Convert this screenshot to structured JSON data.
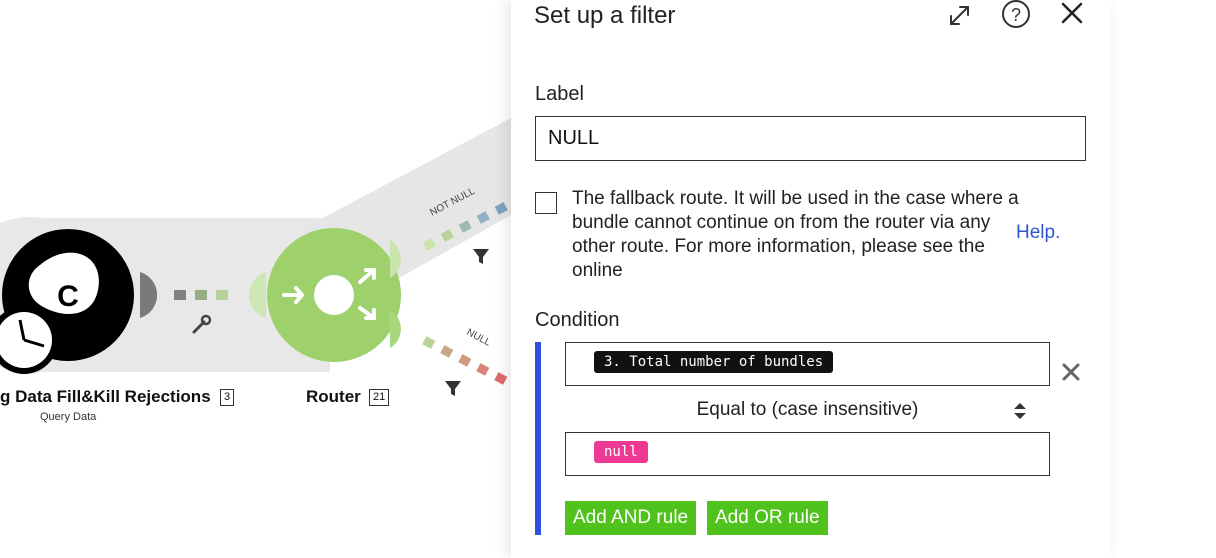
{
  "canvas": {
    "module1": {
      "label": "g Data Fill&Kill Rejections",
      "count": "3",
      "sublabel": "Query Data",
      "icon": "clock-icon"
    },
    "router": {
      "label": "Router",
      "count": "21"
    },
    "route_labels": {
      "upper": "NOT NULL",
      "lower": "NULL"
    },
    "colors": {
      "module_bg": "#000000",
      "router_green": "#9ed16b",
      "connector_gray": "#e2e2e2"
    }
  },
  "panel": {
    "title": "Set up a filter",
    "label_field": {
      "label": "Label",
      "value": "NULL"
    },
    "fallback": {
      "checked": false,
      "text": "The fallback route. It will be used in the case where a bundle cannot continue on from the router via any other route. For more information, please see the online",
      "help_link": "Help."
    },
    "condition": {
      "label": "Condition",
      "left_operand": "3. Total number of bundles",
      "operator": "Equal to (case insensitive)",
      "right_operand": "null",
      "add_and": "Add AND rule",
      "add_or": "Add OR rule"
    },
    "colors": {
      "accent_blue": "#2e4fe3",
      "button_green": "#4fc21b",
      "pill_pink": "#ee3a95",
      "link_blue": "#2f55d4"
    }
  }
}
